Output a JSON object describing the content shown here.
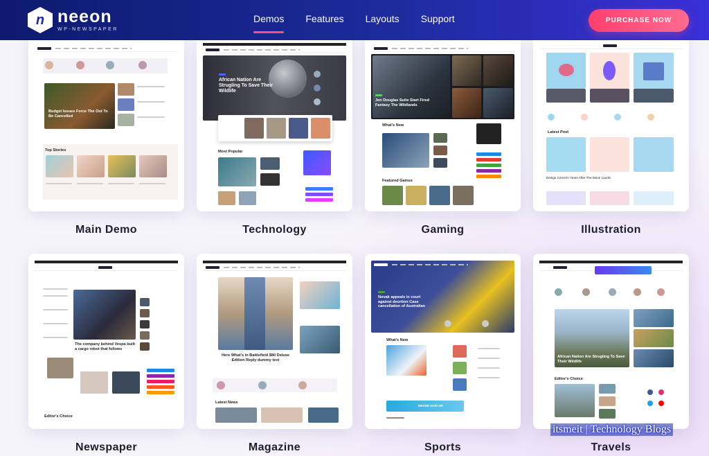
{
  "brand": {
    "name": "neeon",
    "subtitle": "WP-NEWSPAPER",
    "mark": "n"
  },
  "nav": {
    "items": [
      {
        "label": "Demos",
        "active": true
      },
      {
        "label": "Features"
      },
      {
        "label": "Layouts"
      },
      {
        "label": "Support"
      }
    ]
  },
  "cta": {
    "label": "PURCHASE NOW"
  },
  "demos": [
    {
      "label": "Main Demo",
      "texts": {
        "hero": "Budget Issues Force The Out To Be Cancelled",
        "section": "Top Stories"
      }
    },
    {
      "label": "Technology",
      "texts": {
        "hero": "African Nation Are Strugling To Save Their Wildlife",
        "section": "Most Popular"
      }
    },
    {
      "label": "Gaming",
      "texts": {
        "hero": "Jen Douglas Suits Start Fired Fantasy The Wildlands",
        "section": "What's New",
        "section2": "Featured Games"
      }
    },
    {
      "label": "Illustration",
      "texts": {
        "section": "Latest Post",
        "caption": "Design Concern Years After The Moon Landin"
      }
    },
    {
      "label": "Newspaper",
      "texts": {
        "hero": "The company behind Vespa built a cargo robot that follows",
        "section": "Editor's Choice"
      }
    },
    {
      "label": "Magazine",
      "texts": {
        "hero": "Here What's in Battlefield $80 Deluxe Edition Reply dummy text",
        "section": "Latest News"
      }
    },
    {
      "label": "Sports",
      "texts": {
        "hero": "Novak appeals in court against deortion Case cancellation of Australian",
        "section": "What's New",
        "banner": "NEVER GIVE UP"
      }
    },
    {
      "label": "Travels",
      "texts": {
        "hero": "African Nation Are Strugling To Save Their Wildlife",
        "section": "Editor's Choice"
      }
    }
  ],
  "watermark": {
    "text": "itsmeit | Technology Blogs"
  },
  "colors": {
    "header_start": "#0d1a6e",
    "header_end": "#3a2fd8",
    "accent": "#ff4f7b",
    "label": "#1e1d2e"
  }
}
